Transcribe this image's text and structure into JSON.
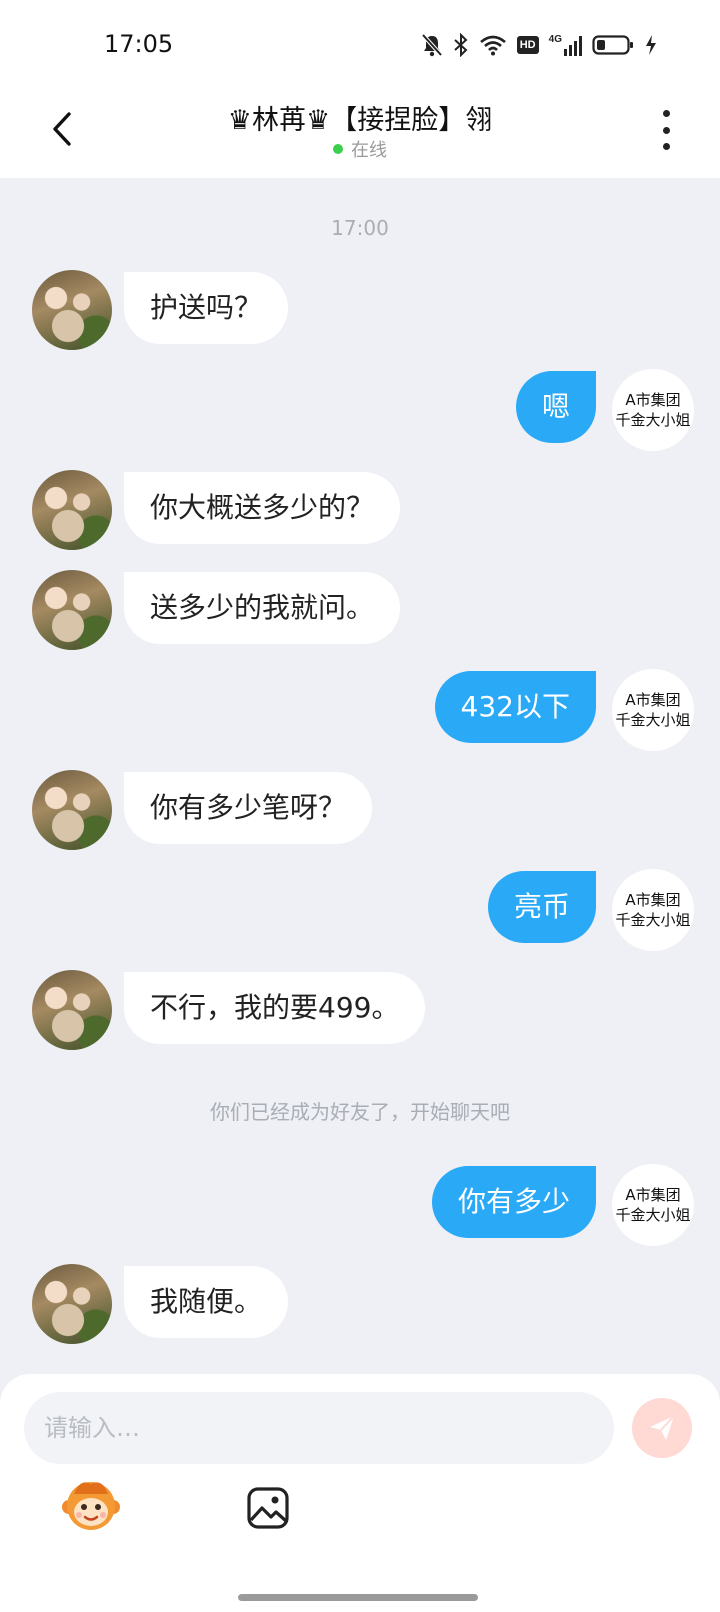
{
  "status_bar": {
    "time": "17:05",
    "icons": [
      "mute-icon",
      "bluetooth-icon",
      "wifi-icon",
      "hd-icon",
      "signal-4g-icon",
      "battery-icon",
      "charging-icon"
    ],
    "hd_label": "HD",
    "network_label": "4G"
  },
  "header": {
    "title": "♛林苒♛【接捏脸】翎",
    "status": "在线",
    "status_color": "#3ccf4e"
  },
  "chat": {
    "timestamp": "17:00",
    "system_message": "你们已经成为好友了，开始聊天吧",
    "my_avatar_lines": [
      "A市集团",
      "千金大小姐"
    ],
    "messages": [
      {
        "side": "left",
        "text": "护送吗？"
      },
      {
        "side": "right",
        "text": "嗯"
      },
      {
        "side": "left",
        "text": "你大概送多少的？"
      },
      {
        "side": "left",
        "text": "送多少的我就问。"
      },
      {
        "side": "right",
        "text": "432以下"
      },
      {
        "side": "left",
        "text": "你有多少笔呀？"
      },
      {
        "side": "right",
        "text": "亮币"
      },
      {
        "side": "left",
        "text": "不行，我的要499。"
      },
      {
        "side": "right",
        "text": "你有多少"
      },
      {
        "side": "left",
        "text": "我随便。"
      }
    ]
  },
  "composer": {
    "placeholder": "请输入…",
    "send_icon": "send-icon",
    "emoji_icon": "monkey-emoji-icon",
    "image_icon": "image-icon"
  },
  "colors": {
    "bubble_mine": "#2aa9f7",
    "bubble_theirs": "#ffffff",
    "background": "#eef0f5"
  }
}
